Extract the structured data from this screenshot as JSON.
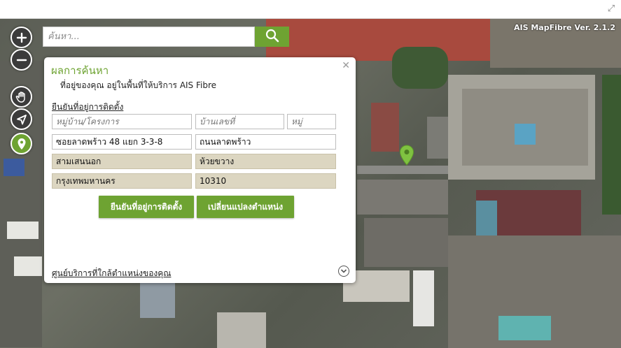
{
  "app": {
    "version": "AIS MapFibre Ver. 2.1.2",
    "expand_icon": "expand-icon"
  },
  "search": {
    "placeholder": "ค้นหา...",
    "value": "",
    "button_icon": "search-icon"
  },
  "map_controls": [
    {
      "name": "zoom-in",
      "icon": "plus-icon"
    },
    {
      "name": "zoom-out",
      "icon": "minus-icon"
    },
    {
      "name": "pan",
      "icon": "hand-icon"
    },
    {
      "name": "locate",
      "icon": "navigate-arrow-icon"
    },
    {
      "name": "pin-mode",
      "icon": "map-pin-icon",
      "active": true
    }
  ],
  "panel": {
    "title": "ผลการค้นหา",
    "status": "ที่อยู่ของคุณ อยู่ในพื้นที่ให้บริการ AIS Fibre",
    "confirm_link": "ยืนยันที่อยู่การติดตั้ง",
    "fields": {
      "village_placeholder": "หมู่บ้าน/โครงการ",
      "house_no_placeholder": "บ้านเลขที่",
      "moo_placeholder": "หมู่",
      "soi": "ซอยลาดพร้าว 48 แยก 3-3-8",
      "road": "ถนนลาดพร้าว",
      "district": "สามเสนนอก",
      "subdistrict": "ห้วยขวาง",
      "province": "กรุงเทพมหานคร",
      "postcode": "10310"
    },
    "confirm_button": "ยืนยันที่อยู่การติดตั้ง",
    "change_button": "เปลี่ยนแปลงตำแหน่ง",
    "nearby_link": "ศูนย์บริการที่ใกล้ตำแหน่งของคุณ",
    "close_icon": "close-icon",
    "expand_icon": "chevron-down-icon"
  },
  "colors": {
    "accent": "#6ea332",
    "readonly_field": "#dcd6c1"
  }
}
